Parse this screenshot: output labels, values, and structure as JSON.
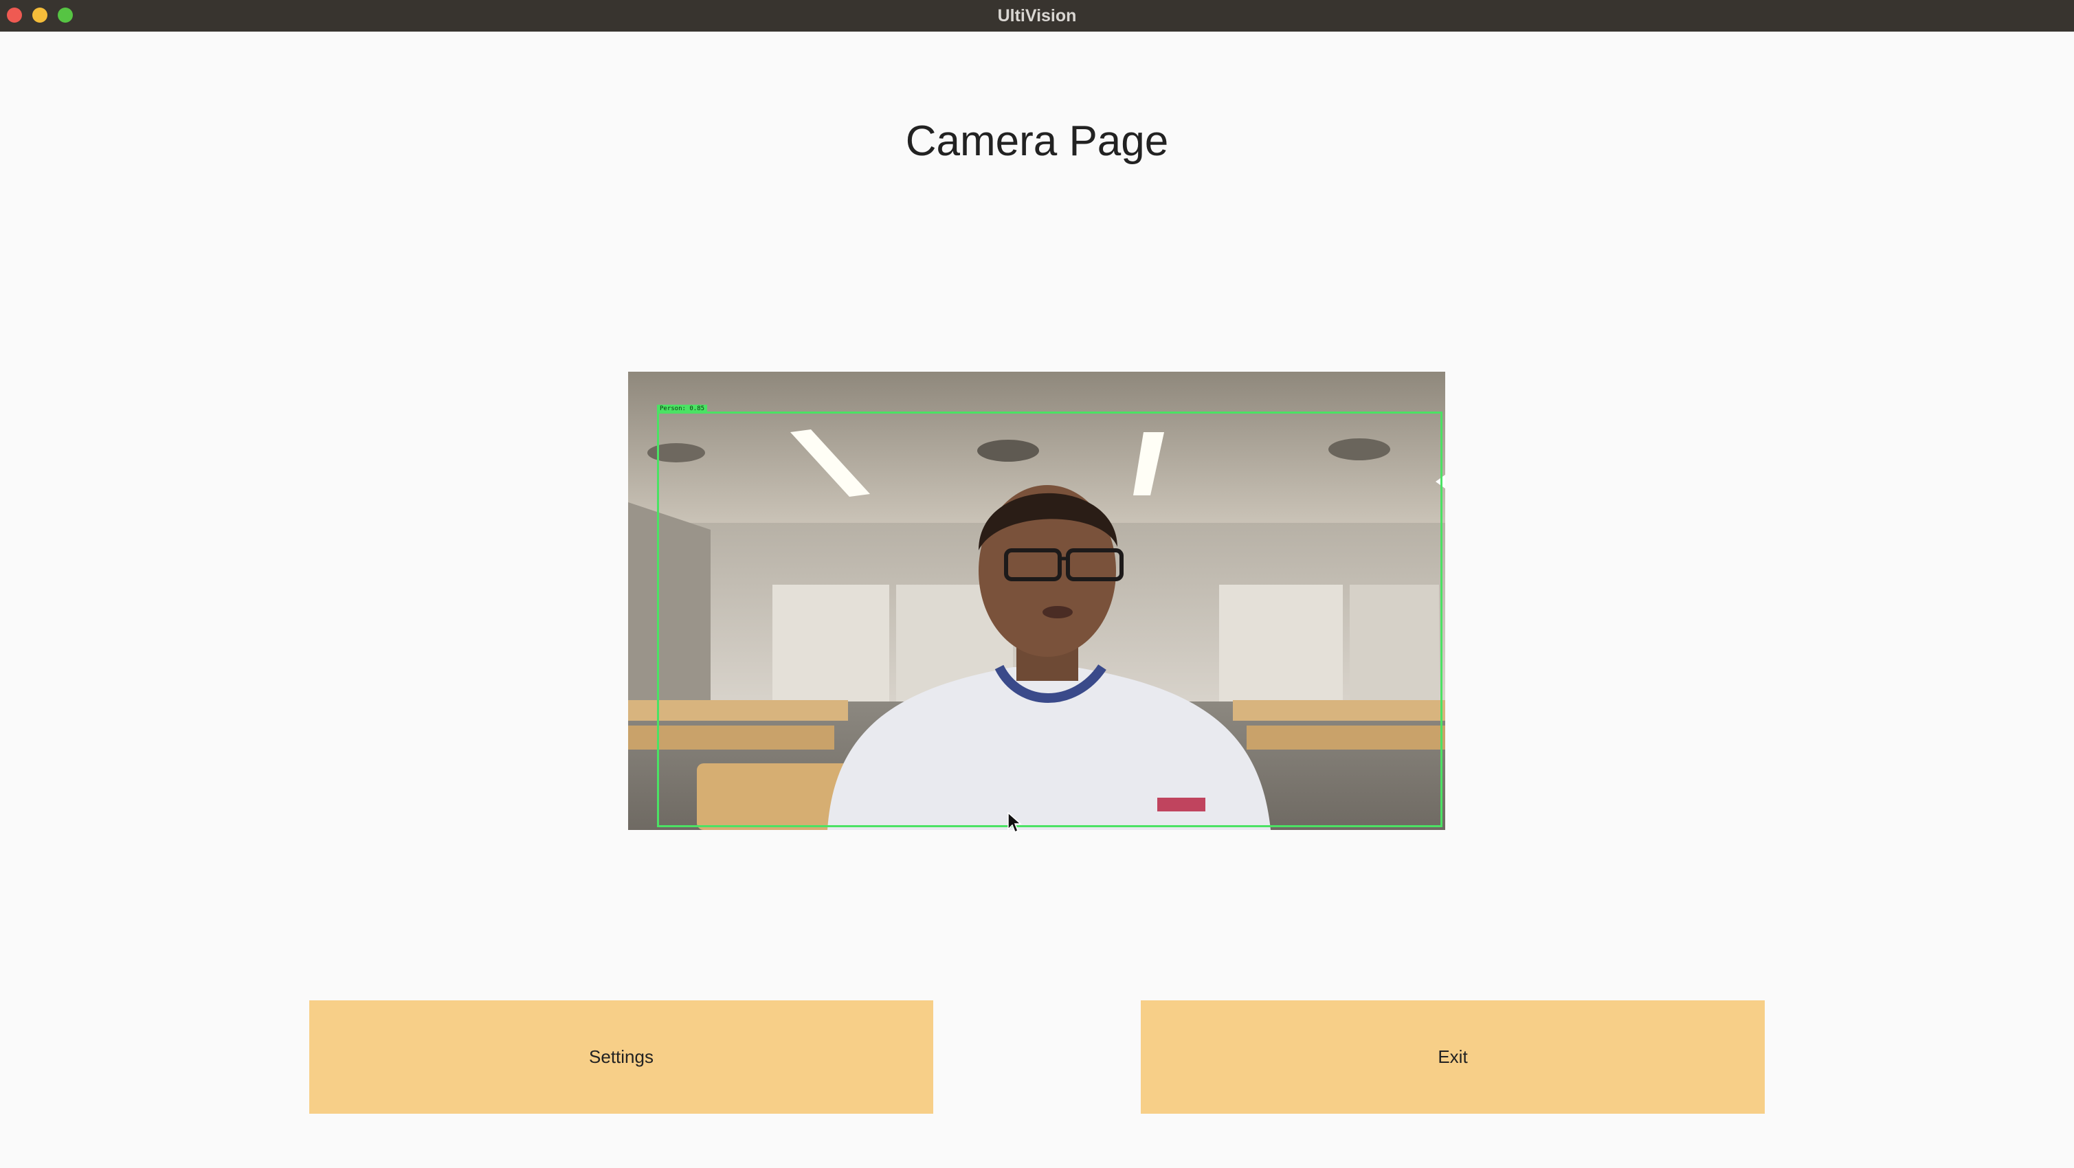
{
  "window": {
    "title": "UltiVision"
  },
  "page": {
    "title": "Camera Page"
  },
  "camera": {
    "detection_label": "Person: 0.85"
  },
  "buttons": {
    "settings_label": "Settings",
    "exit_label": "Exit"
  },
  "colors": {
    "button_bg": "#f7cf88",
    "detection_box": "#4be264",
    "titlebar": "#38342f",
    "background": "#fafafa"
  },
  "icons": {
    "cursor": "mouse-pointer-icon"
  }
}
